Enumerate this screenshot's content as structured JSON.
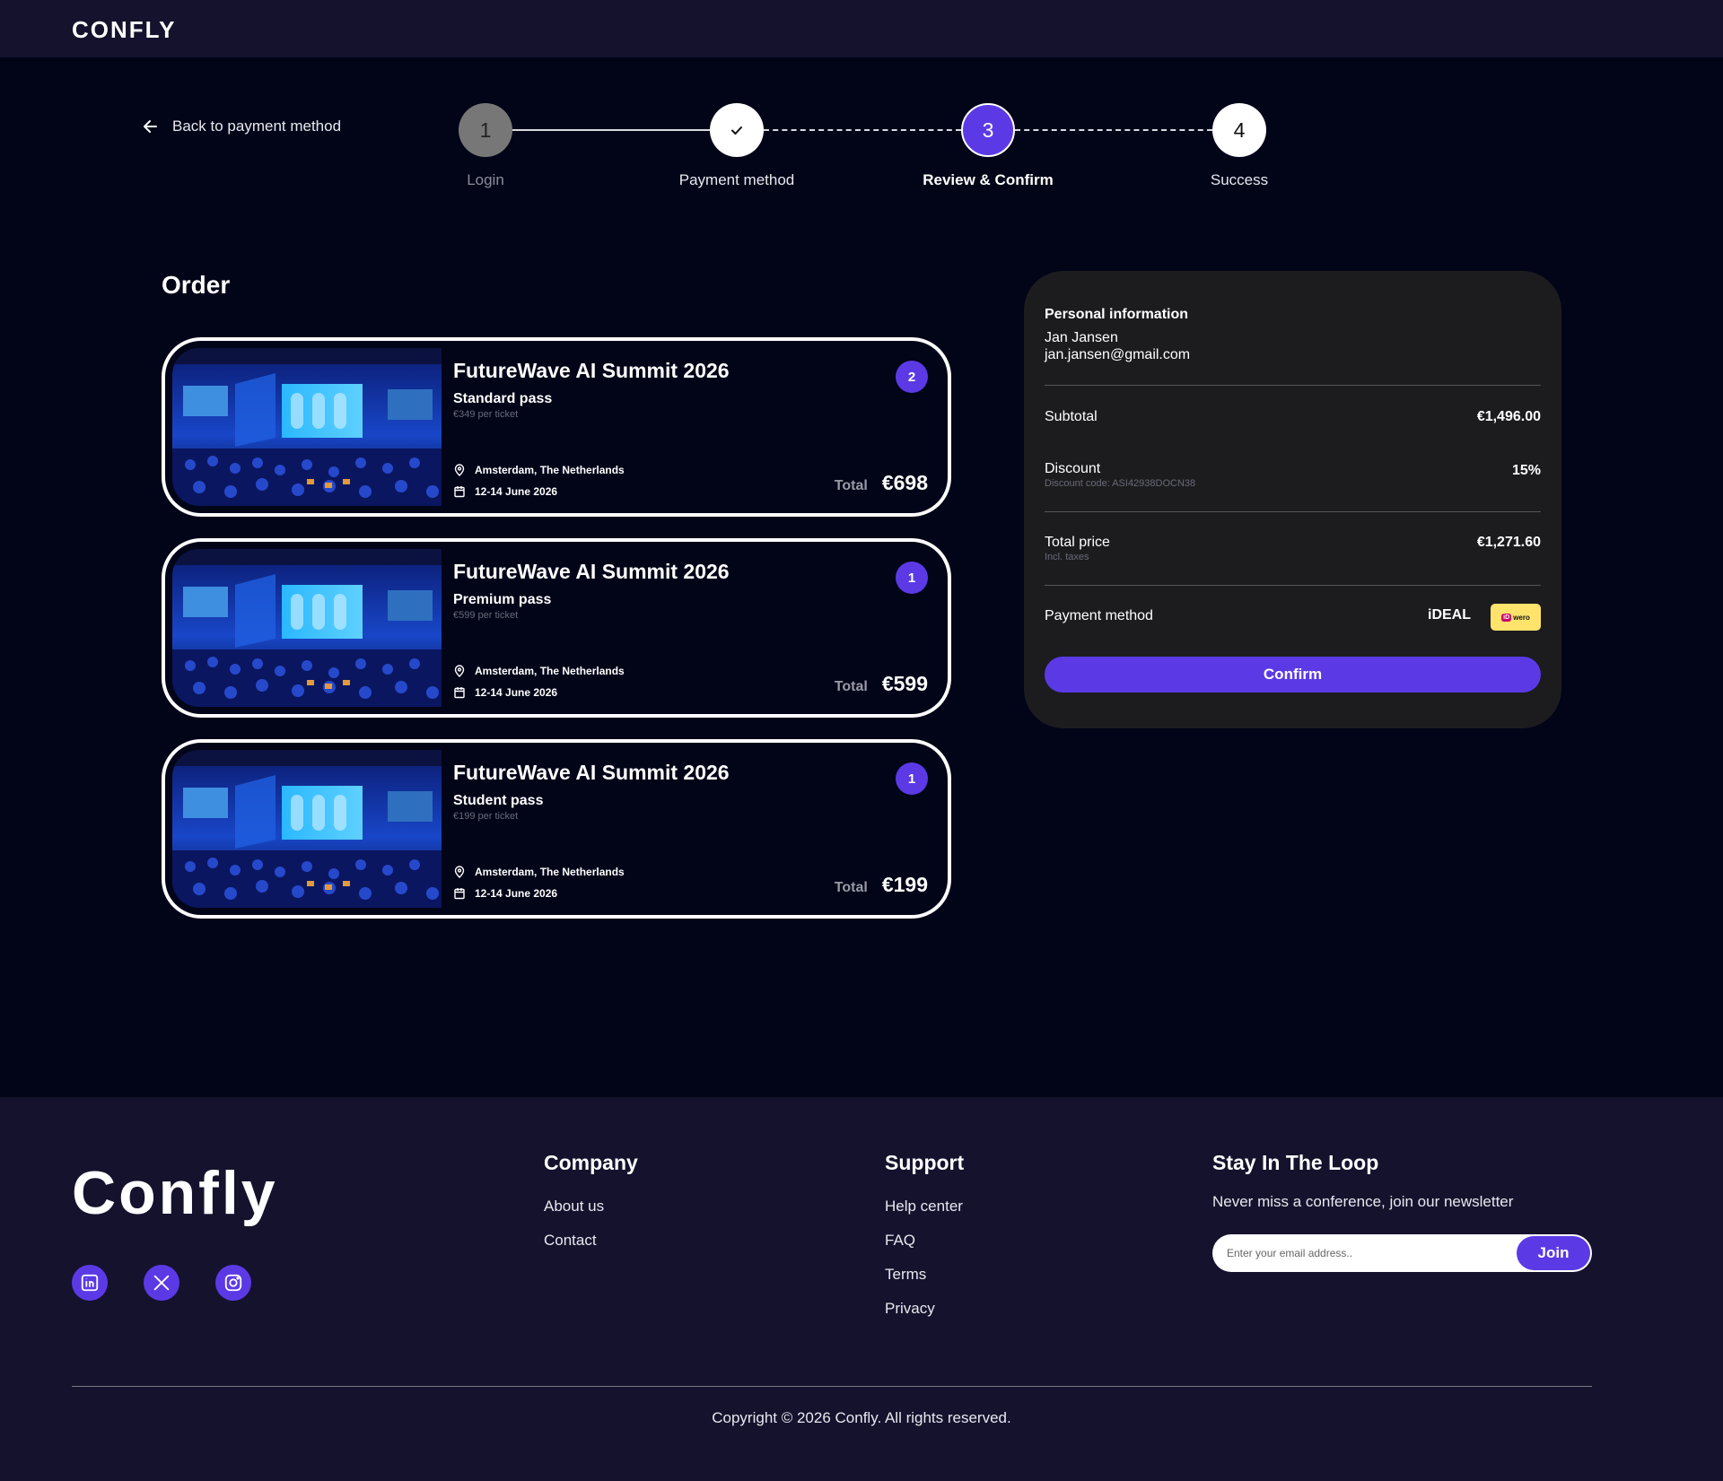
{
  "header": {
    "brand": "CONFLY"
  },
  "nav": {
    "back_label": "Back to payment method"
  },
  "stepper": {
    "steps": [
      {
        "number": "1",
        "label": "Login",
        "state": "done-inactive"
      },
      {
        "number": "",
        "label": "Payment method",
        "state": "completed",
        "icon": "check-icon"
      },
      {
        "number": "3",
        "label": "Review & Confirm",
        "state": "current"
      },
      {
        "number": "4",
        "label": "Success",
        "state": "upcoming"
      }
    ]
  },
  "order": {
    "title": "Order",
    "tickets": [
      {
        "event": "FutureWave AI Summit 2026",
        "pass": "Standard pass",
        "unit_price": "€349 per ticket",
        "quantity": "2",
        "location": "Amsterdam, The Netherlands",
        "dates": "12-14 June 2026",
        "total_label": "Total",
        "total": "€698"
      },
      {
        "event": "FutureWave AI Summit 2026",
        "pass": "Premium pass",
        "unit_price": "€599 per ticket",
        "quantity": "1",
        "location": "Amsterdam, The Netherlands",
        "dates": "12-14 June 2026",
        "total_label": "Total",
        "total": "€599"
      },
      {
        "event": "FutureWave AI Summit 2026",
        "pass": "Student pass",
        "unit_price": "€199 per ticket",
        "quantity": "1",
        "location": "Amsterdam, The Netherlands",
        "dates": "12-14 June 2026",
        "total_label": "Total",
        "total": "€199"
      }
    ]
  },
  "summary": {
    "personal_heading": "Personal information",
    "name": "Jan Jansen",
    "email": "jan.jansen@gmail.com",
    "subtotal_label": "Subtotal",
    "subtotal": "€1,496.00",
    "discount_label": "Discount",
    "discount_code": "Discount code: ASI42938DOCN38",
    "discount": "15%",
    "total_label": "Total price",
    "total_note": "Incl. taxes",
    "total": "€1,271.60",
    "payment_label": "Payment method",
    "payment_method": "iDEAL",
    "payment_logo_text": "wero",
    "confirm_label": "Confirm"
  },
  "footer": {
    "logo": "Confly",
    "socials": [
      "linkedin-icon",
      "x-icon",
      "instagram-icon"
    ],
    "company_title": "Company",
    "company_links": [
      "About us",
      "Contact"
    ],
    "support_title": "Support",
    "support_links": [
      "Help center",
      "FAQ",
      "Terms",
      "Privacy"
    ],
    "newsletter_title": "Stay In The Loop",
    "newsletter_desc": "Never miss a conference, join our newsletter",
    "newsletter_placeholder": "Enter your email address..",
    "join_label": "Join",
    "copyright": "Copyright © 2026 Confly. All rights reserved."
  },
  "colors": {
    "accent": "#5b3ae6",
    "background": "#020418",
    "header_bg": "#15122d",
    "panel_bg": "#1c1c1f"
  }
}
